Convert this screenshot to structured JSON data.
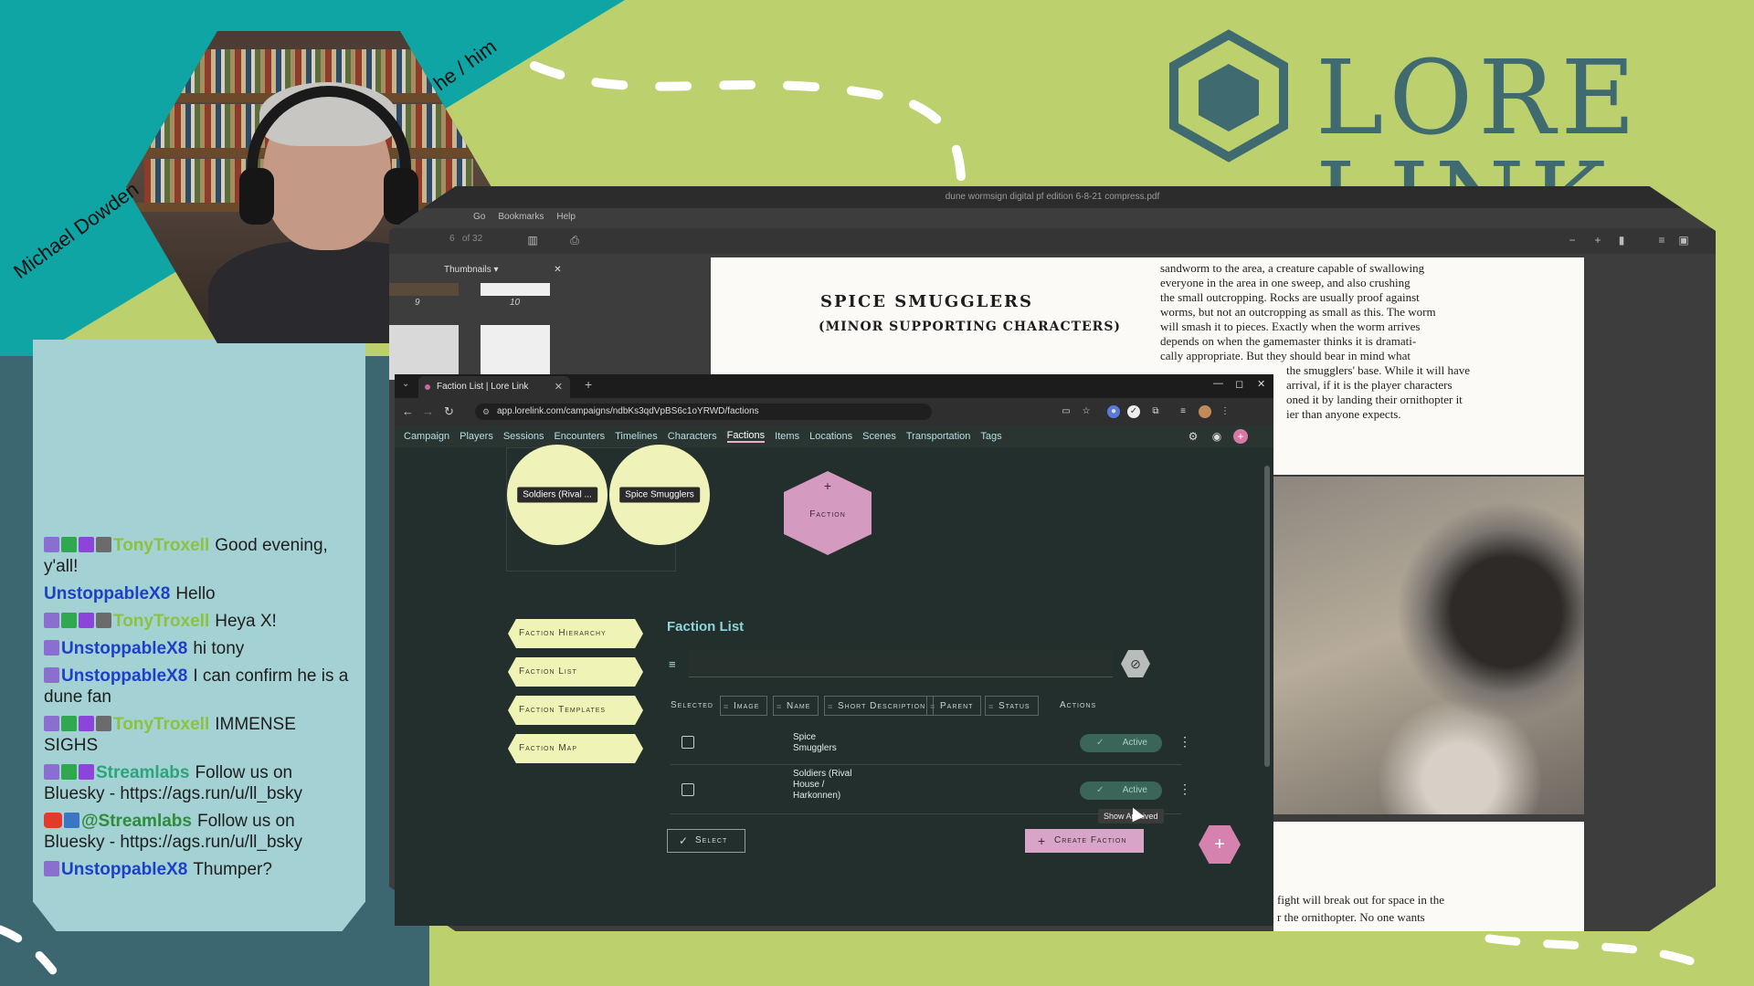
{
  "overlay": {
    "streamer_name": "Michael Dowden",
    "pronouns": "he / him",
    "brand_text": "LORE LINK",
    "colors": {
      "background": "#bcd06e",
      "teal": "#0fa5a5",
      "panel": "#a4d1d3",
      "dark_teal": "#3c6670",
      "brand": "#3f6a70"
    }
  },
  "pdf": {
    "window_title": "dune wormsign digital pf edition 6-8-21 compress.pdf",
    "menu": [
      "Go",
      "Bookmarks",
      "Help"
    ],
    "page_indicator": "of 32",
    "page_current": "6",
    "thumbnails_label": "Thumbnails",
    "thumb_numbers": [
      "9",
      "10"
    ],
    "section_title": "SPICE SMUGGLERS",
    "section_subtitle": "(MINOR SUPPORTING CHARACTERS)",
    "body_lines": [
      "sandworm to the area, a creature capable of swallowing",
      "everyone in the area in one sweep, and also crushing",
      "the small outcropping. Rocks are usually proof against",
      "worms, but not an outcropping as small as this. The worm",
      "will smash it to pieces. Exactly when the worm arrives",
      "depends on when the gamemaster thinks it is dramati-",
      "cally appropriate. But they should bear in mind what",
      "the smugglers' base. While it will have",
      "arrival, if it is the player characters",
      "oned it by landing their ornithopter it",
      "ier than anyone expects."
    ],
    "bottom_lines": [
      "fight will break out for space in the",
      "r the ornithopter. No one wants"
    ]
  },
  "browser": {
    "tab_title": "Faction List | Lore Link",
    "url": "app.lorelink.com/campaigns/ndbKs3qdVpBS6c1oYRWD/factions"
  },
  "app": {
    "nav": [
      "Campaign",
      "Players",
      "Sessions",
      "Encounters",
      "Timelines",
      "Characters",
      "Factions",
      "Items",
      "Locations",
      "Scenes",
      "Transportation",
      "Tags"
    ],
    "active_nav": "Factions",
    "hierarchy_nodes": [
      "Soldiers (Rival ...",
      "Spice Smugglers"
    ],
    "hex_node_label": "Faction",
    "hex_node_plus": "+",
    "side_buttons": [
      "Faction Hierarchy",
      "Faction List",
      "Faction Templates",
      "Faction Map"
    ],
    "list_title": "Faction List",
    "filter_value": "",
    "columns": {
      "selected": "Selected",
      "image": "Image",
      "name": "Name",
      "short_description": "Short Description",
      "parent": "Parent",
      "status": "Status",
      "actions": "Actions"
    },
    "rows": [
      {
        "name": "Spice Smugglers",
        "status": "Active",
        "checked": false
      },
      {
        "name": "Soldiers (Rival House / Harkonnen)",
        "status": "Active",
        "checked": false
      }
    ],
    "tooltip": "Show Archived",
    "select_button": "Select",
    "create_button": "Create Faction",
    "fab_plus": "+",
    "colors": {
      "accent_pink": "#d8a4c8",
      "node_yellow": "#f0f3b9",
      "title_teal": "#8fd4d9",
      "bg": "#222f2c"
    }
  },
  "chat": [
    {
      "badges": [
        "twitch",
        "mod",
        "star",
        "gift"
      ],
      "user": "TonyTroxell",
      "user_color": "#8bc23f",
      "text": "Good evening, y'all!"
    },
    {
      "badges": [],
      "user": "UnstoppableX8",
      "user_color": "#1e3fc7",
      "text": "Hello"
    },
    {
      "badges": [
        "twitch",
        "mod",
        "star",
        "gift"
      ],
      "user": "TonyTroxell",
      "user_color": "#8bc23f",
      "text": "Heya X!"
    },
    {
      "badges": [
        "twitch"
      ],
      "user": "UnstoppableX8",
      "user_color": "#1e3fc7",
      "text": "hi tony"
    },
    {
      "badges": [
        "twitch"
      ],
      "user": "UnstoppableX8",
      "user_color": "#1e3fc7",
      "text": "I can confirm he is a dune fan"
    },
    {
      "badges": [
        "twitch",
        "mod",
        "star",
        "gift"
      ],
      "user": "TonyTroxell",
      "user_color": "#8bc23f",
      "text": "IMMENSE SIGHS"
    },
    {
      "badges": [
        "twitch",
        "mod",
        "star"
      ],
      "user": "Streamlabs",
      "user_color": "#2aa57c",
      "text": "Follow us on Bluesky - https://ags.run/u/ll_bsky"
    },
    {
      "badges": [
        "yt",
        "wrench"
      ],
      "user": "@Streamlabs",
      "user_color": "#2d8d38",
      "text": "Follow us on Bluesky - https://ags.run/u/ll_bsky"
    },
    {
      "badges": [
        "twitch"
      ],
      "user": "UnstoppableX8",
      "user_color": "#1e3fc7",
      "text": "Thumper?"
    }
  ]
}
